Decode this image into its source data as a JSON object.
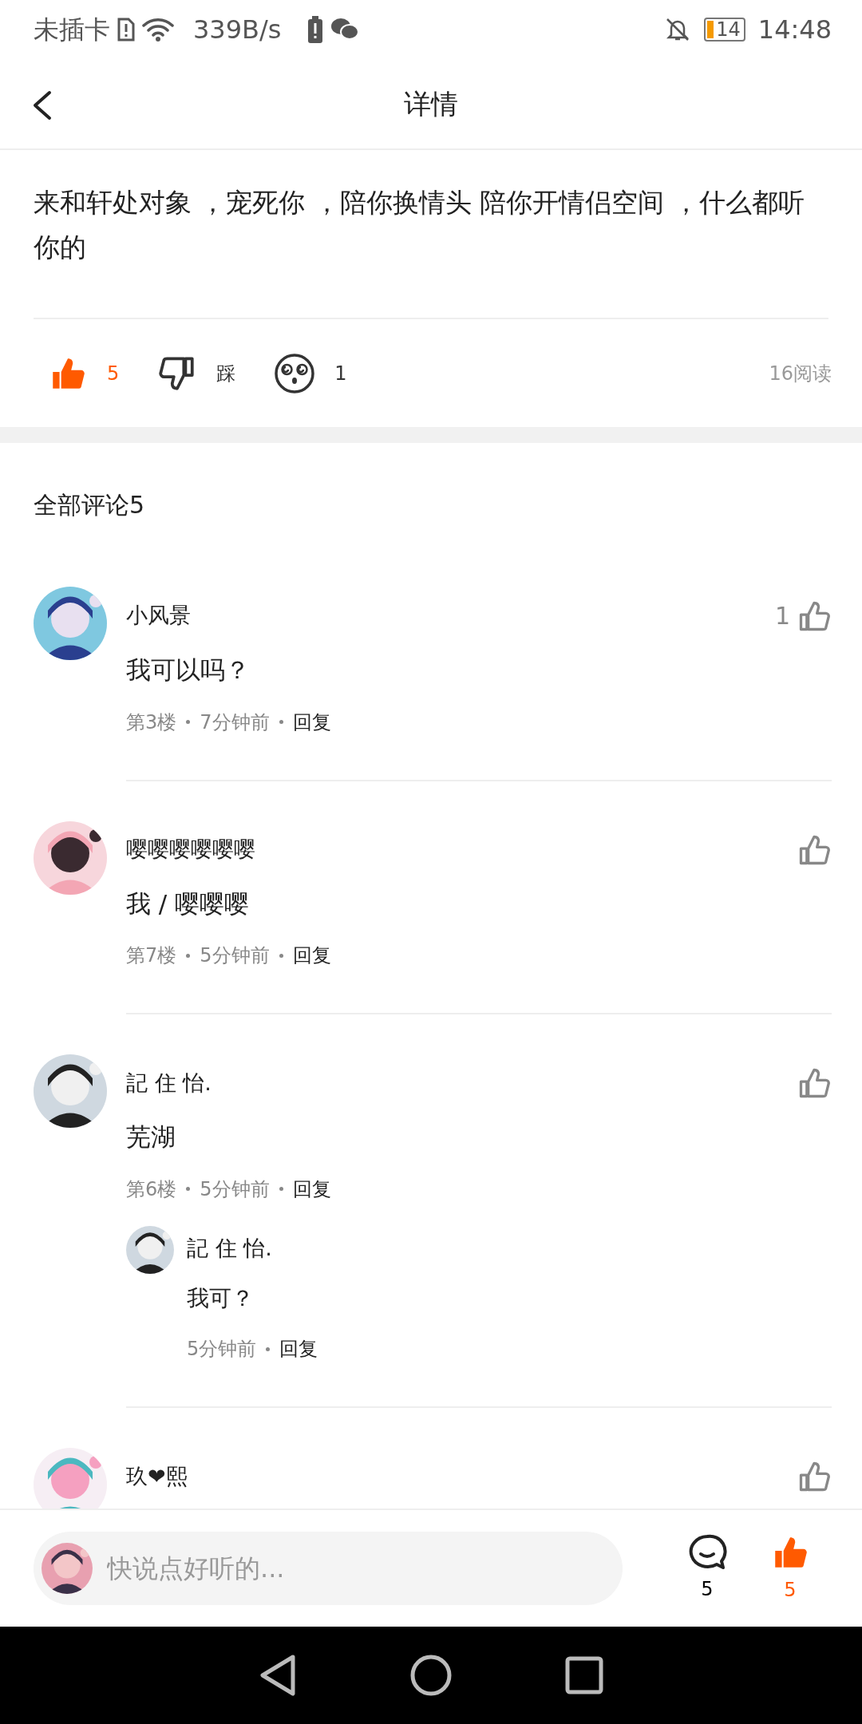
{
  "status_bar": {
    "carrier": "未插卡",
    "speed": "339B/s",
    "battery": "14",
    "time": "14:48"
  },
  "header": {
    "title": "详情"
  },
  "post": {
    "text": "来和轩处对象 ，宠死你 ，陪你换情头 陪你开情侣空间 ，什么都听你的",
    "like": {
      "count": "5",
      "selected": true
    },
    "dislike": {
      "label": "踩"
    },
    "reaction": {
      "count": "1"
    },
    "reads": "16阅读"
  },
  "comments_title": "全部评论5",
  "comments": [
    {
      "user": "小风景",
      "text": "我可以吗？",
      "floor": "第3楼",
      "time": "7分钟前",
      "reply": "回复",
      "likes": "1",
      "liked": false
    },
    {
      "user": "嘤嘤嘤嘤嘤嘤",
      "text": "我 / 嘤嘤嘤",
      "floor": "第7楼",
      "time": "5分钟前",
      "reply": "回复",
      "liked": false
    },
    {
      "user": "記 住 怡.",
      "text": "芜湖",
      "floor": "第6楼",
      "time": "5分钟前",
      "reply": "回复",
      "liked": false,
      "replies": [
        {
          "user": "記 住 怡.",
          "text": "我可？",
          "time": "5分钟前",
          "reply": "回复"
        }
      ]
    },
    {
      "user": "玖❤熙",
      "liked": false
    }
  ],
  "bottom_bar": {
    "placeholder": "快说点好听的...",
    "comments": "5",
    "likes": "5",
    "liked": true
  }
}
